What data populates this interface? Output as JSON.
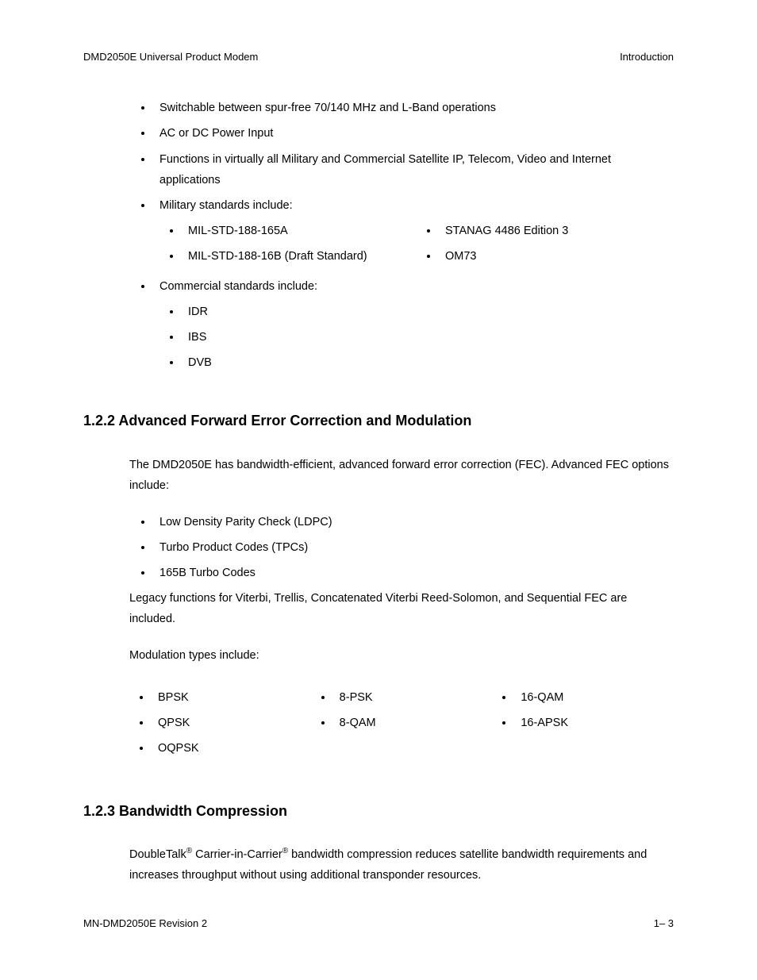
{
  "header": {
    "left": "DMD2050E Universal Product Modem",
    "right": "Introduction"
  },
  "top_bullets": {
    "b1": "Switchable between spur-free 70/140 MHz and L-Band operations",
    "b2": "AC or DC Power Input",
    "b3": "Functions in virtually all Military and Commercial Satellite IP, Telecom, Video and Internet applications",
    "b4": "Military standards include:",
    "mil": {
      "l1": "MIL-STD-188-165A",
      "l2": "MIL-STD-188-16B (Draft Standard)",
      "r1": "STANAG 4486 Edition 3",
      "r2": "OM73"
    },
    "b5": "Commercial standards include:",
    "com": {
      "c1": "IDR",
      "c2": "IBS",
      "c3": "DVB"
    }
  },
  "section122": {
    "heading": "1.2.2  Advanced Forward Error Correction and Modulation",
    "p1": "The DMD2050E has bandwidth-efficient, advanced forward error correction (FEC).  Advanced FEC options include:",
    "fec": {
      "f1": "Low Density Parity Check (LDPC)",
      "f2": "Turbo Product Codes (TPCs)",
      "f3": "165B Turbo Codes"
    },
    "p2": "Legacy functions for Viterbi, Trellis, Concatenated Viterbi Reed-Solomon, and Sequential FEC are included.",
    "p3": "Modulation types include:",
    "mod": {
      "c1r1": "BPSK",
      "c1r2": "QPSK",
      "c1r3": "OQPSK",
      "c2r1": "8-PSK",
      "c2r2": "8-QAM",
      "c3r1": "16-QAM",
      "c3r2": "16-APSK"
    }
  },
  "section123": {
    "heading": "1.2.3  Bandwidth Compression",
    "p1_a": "DoubleTalk",
    "p1_b": " Carrier-in-Carrier",
    "p1_c": " bandwidth compression reduces satellite bandwidth requirements and increases throughput without using additional transponder resources.",
    "reg": "®"
  },
  "footer": {
    "left": "MN-DMD2050E  Revision 2",
    "right": "1–  3"
  }
}
